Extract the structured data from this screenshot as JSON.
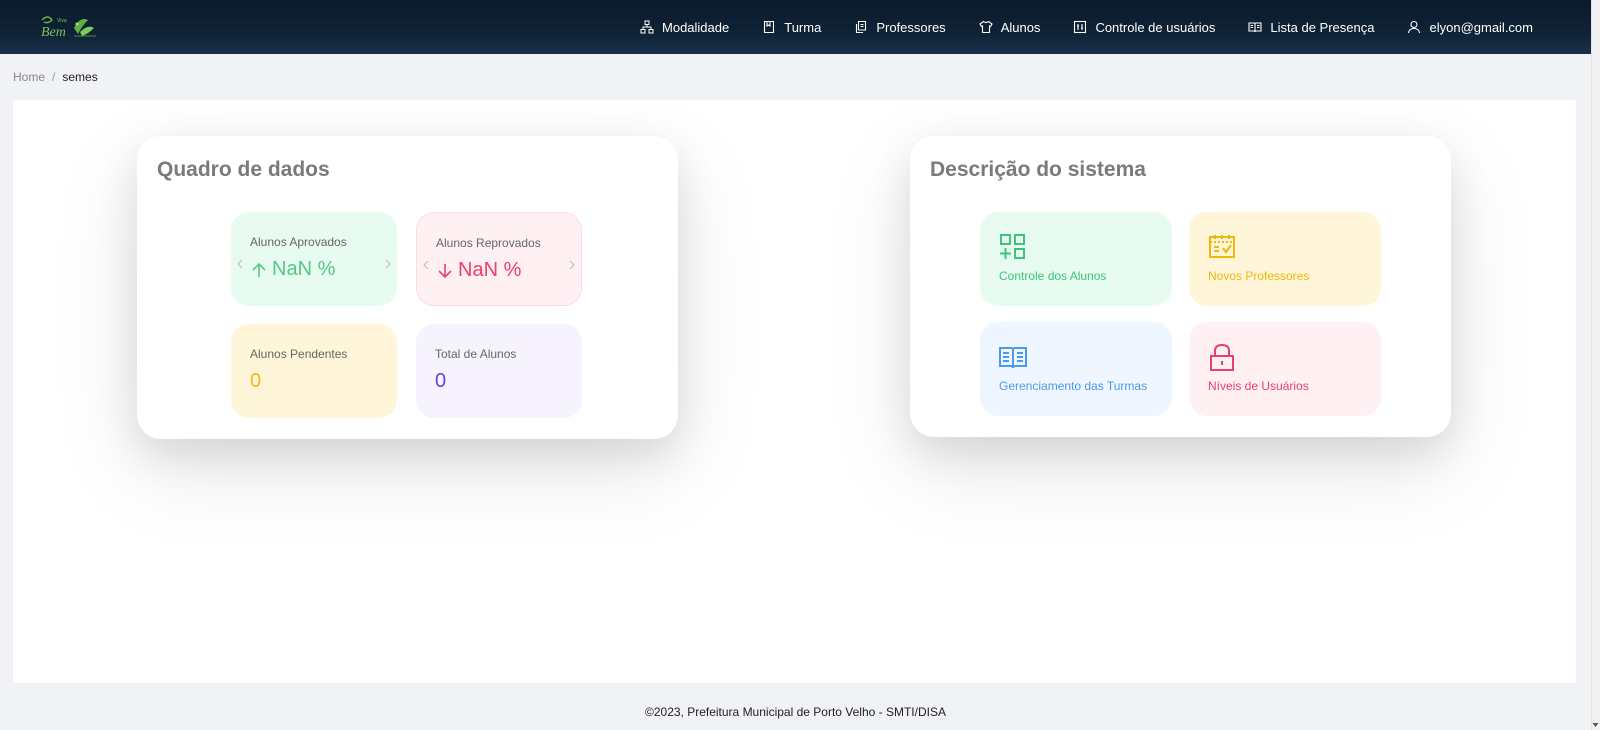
{
  "header": {
    "logo_alt": "Viva Bem",
    "nav": [
      {
        "label": "Modalidade",
        "icon": "sitemap-icon"
      },
      {
        "label": "Turma",
        "icon": "book-icon"
      },
      {
        "label": "Professores",
        "icon": "documents-icon"
      },
      {
        "label": "Alunos",
        "icon": "shirt-icon"
      },
      {
        "label": "Controle de usuários",
        "icon": "control-panel-icon"
      },
      {
        "label": "Lista de Presença",
        "icon": "open-book-icon"
      },
      {
        "label": "elyon@gmail.com",
        "icon": "user-icon"
      }
    ]
  },
  "breadcrumb": {
    "home": "Home",
    "separator": "/",
    "current": "semes"
  },
  "dashboard": {
    "title": "Quadro de dados",
    "stats": {
      "approved": {
        "label": "Alunos Aprovados",
        "value": "NaN %",
        "color": "#56c785"
      },
      "failed": {
        "label": "Alunos Reprovados",
        "value": "NaN %",
        "color": "#ee3d67"
      },
      "pending": {
        "label": "Alunos Pendentes",
        "value": "0",
        "color": "#f6b90e"
      },
      "total": {
        "label": "Total de Alunos",
        "value": "0",
        "color": "#6d3fe0"
      }
    }
  },
  "system": {
    "title": "Descrição do sistema",
    "features": [
      {
        "label": "Controle dos Alunos",
        "icon": "grid-add-icon",
        "color": "#3ec47e"
      },
      {
        "label": "Novos Professores",
        "icon": "calendar-check-icon",
        "color": "#eeb80b"
      },
      {
        "label": "Gerenciamento das Turmas",
        "icon": "book-open-icon",
        "color": "#4a9bea"
      },
      {
        "label": "Níveis de Usuários",
        "icon": "lock-icon",
        "color": "#ea3d72"
      }
    ]
  },
  "footer": {
    "text": "©2023, Prefeitura Municipal de Porto Velho - SMTI/DISA"
  }
}
